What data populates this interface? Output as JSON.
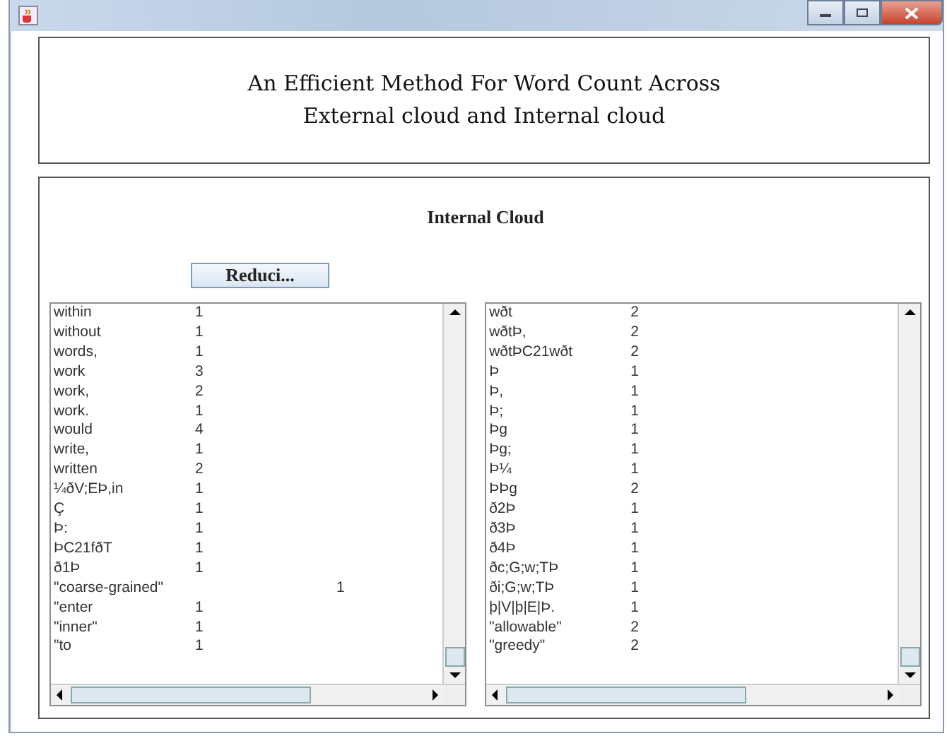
{
  "heading": {
    "lines": [
      "An Efficient Method For Word Count Across",
      "External cloud and Internal cloud"
    ]
  },
  "panel": {
    "title": "Internal Cloud",
    "button": "Reduci..."
  },
  "lists": [
    {
      "rows": [
        {
          "word": "within",
          "count": "1"
        },
        {
          "word": "without",
          "count": "1"
        },
        {
          "word": "words,",
          "count": "1"
        },
        {
          "word": "work",
          "count": "3"
        },
        {
          "word": "work,",
          "count": "2"
        },
        {
          "word": "work.",
          "count": "1"
        },
        {
          "word": "would",
          "count": "4"
        },
        {
          "word": "write,",
          "count": "1"
        },
        {
          "word": "written",
          "count": "2"
        },
        {
          "word": "¼ðV;EÞ,in",
          "count": "1"
        },
        {
          "word": "Ç",
          "count": "1"
        },
        {
          "word": "Þ:",
          "count": "1"
        },
        {
          "word": "ÞC21fðT",
          "count": "1"
        },
        {
          "word": "ð1Þ",
          "count": "1"
        },
        {
          "word": "\"coarse-grained\"",
          "count": "1"
        },
        {
          "word": "\"enter",
          "count": "1"
        },
        {
          "word": "\"inner\"",
          "count": "1"
        },
        {
          "word": "\"to",
          "count": "1"
        }
      ]
    },
    {
      "rows": [
        {
          "word": "wðt",
          "count": "2"
        },
        {
          "word": "wðtÞ,",
          "count": "2"
        },
        {
          "word": "wðtÞC21wðt",
          "count": "2"
        },
        {
          "word": "Þ",
          "count": "1"
        },
        {
          "word": "Þ,",
          "count": "1"
        },
        {
          "word": "Þ;",
          "count": "1"
        },
        {
          "word": "Þg",
          "count": "1"
        },
        {
          "word": "Þg;",
          "count": "1"
        },
        {
          "word": "Þ¼",
          "count": "1"
        },
        {
          "word": "ÞÞg",
          "count": "2"
        },
        {
          "word": "ð2Þ",
          "count": "1"
        },
        {
          "word": "ð3Þ",
          "count": "1"
        },
        {
          "word": "ð4Þ",
          "count": "1"
        },
        {
          "word": "ðc;G;w;TÞ",
          "count": "1"
        },
        {
          "word": "ði;G;w;TÞ",
          "count": "1"
        },
        {
          "word": "þ|V|þ|E|Þ.",
          "count": "1"
        },
        {
          "word": "\"allowable\"",
          "count": "2"
        },
        {
          "word": "\"greedy\"",
          "count": "2"
        }
      ]
    }
  ]
}
